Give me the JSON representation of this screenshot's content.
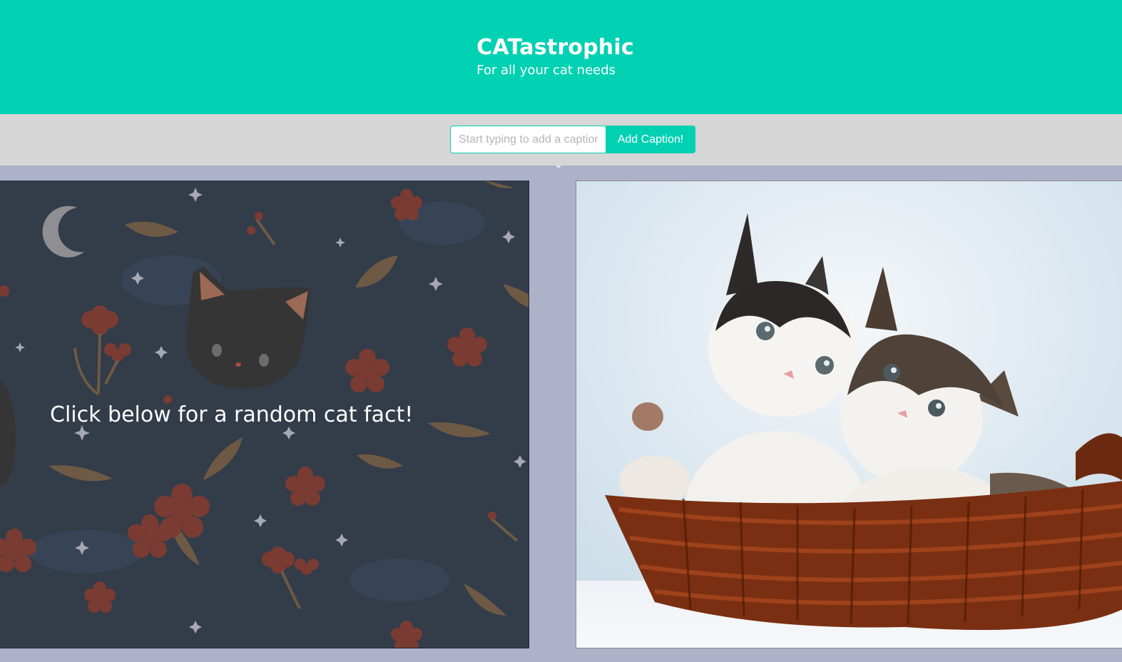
{
  "hero": {
    "title": "CATastrophic",
    "subtitle": "For all your cat needs"
  },
  "caption": {
    "placeholder": "Start typing to add a caption",
    "button_label": "Add Caption!"
  },
  "fact_panel": {
    "text": "Click below for a random cat fact!"
  },
  "colors": {
    "brand": "#00d1b2",
    "caption_bar": "#d6d6d6",
    "page_bg": "#adb2ca",
    "fact_bg": "#333c49"
  },
  "photo": {
    "icon": "kittens-in-basket-image"
  }
}
